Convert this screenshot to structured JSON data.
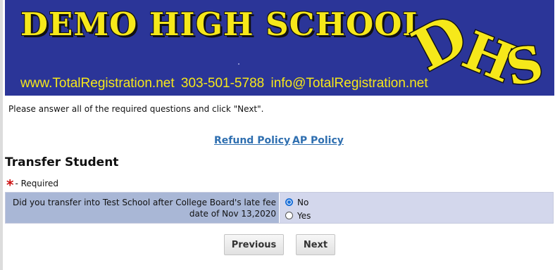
{
  "banner": {
    "title": "DEMO HIGH SCHOOL",
    "contact": "www.TotalRegistration.net   303-501-5788   info@TotalRegistration.net",
    "logo_text": "DHS",
    "colors": {
      "background": "#2b3598",
      "text": "#f6e81a"
    }
  },
  "intro_text": "Please answer all of the required questions and click \"Next\".",
  "links": {
    "refund": "Refund Policy",
    "ap": "AP Policy"
  },
  "section": {
    "title": "Transfer Student",
    "required_marker": "*",
    "required_note": "- Required"
  },
  "question": {
    "label": "Did you transfer into Test School after College Board's late fee date of Nov 13,2020",
    "options": [
      {
        "label": "No",
        "selected": true
      },
      {
        "label": "Yes",
        "selected": false
      }
    ]
  },
  "buttons": {
    "previous": "Previous",
    "next": "Next"
  }
}
